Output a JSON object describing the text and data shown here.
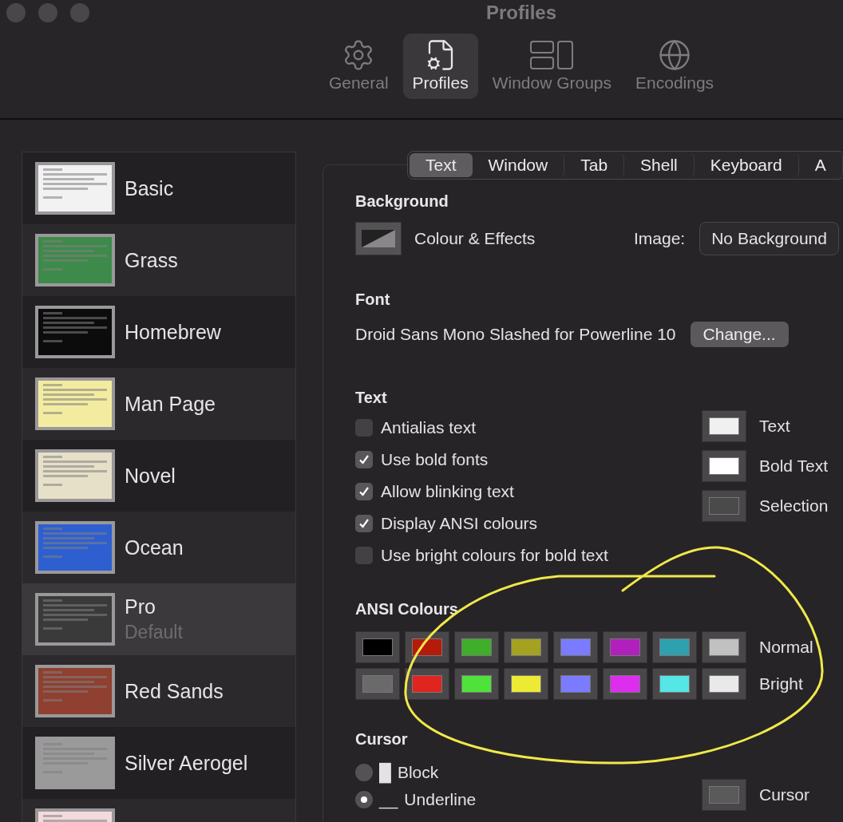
{
  "window": {
    "title": "Profiles"
  },
  "toolbar": [
    {
      "label": "General",
      "kind": "gear",
      "selected": false
    },
    {
      "label": "Profiles",
      "kind": "profile",
      "selected": true
    },
    {
      "label": "Window Groups",
      "kind": "groups",
      "selected": false
    },
    {
      "label": "Encodings",
      "kind": "globe",
      "selected": false
    }
  ],
  "profiles": [
    {
      "name": "Basic",
      "color": "#f2f2f2",
      "selected": false
    },
    {
      "name": "Grass",
      "color": "#3e8a4a",
      "selected": false
    },
    {
      "name": "Homebrew",
      "color": "#0c0c0c",
      "selected": false
    },
    {
      "name": "Man Page",
      "color": "#f3eca0",
      "selected": false
    },
    {
      "name": "Novel",
      "color": "#e6e0c8",
      "selected": false
    },
    {
      "name": "Ocean",
      "color": "#2d5fd0",
      "selected": false
    },
    {
      "name": "Pro",
      "subtitle": "Default",
      "color": "#3a3a3a",
      "selected": true
    },
    {
      "name": "Red Sands",
      "color": "#8f4030",
      "selected": false
    },
    {
      "name": "Silver Aerogel",
      "color": "#9a9a9a",
      "selected": false
    },
    {
      "color": "#f2dadd",
      "selected": false
    }
  ],
  "tabs": [
    {
      "label": "Text",
      "selected": true
    },
    {
      "label": "Window",
      "selected": false
    },
    {
      "label": "Tab",
      "selected": false
    },
    {
      "label": "Shell",
      "selected": false
    },
    {
      "label": "Keyboard",
      "selected": false
    },
    {
      "label": "A",
      "selected": false
    }
  ],
  "background": {
    "heading": "Background",
    "label": "Colour & Effects",
    "image_label": "Image:",
    "image_value": "No Background"
  },
  "font": {
    "heading": "Font",
    "value": "Droid Sans Mono Slashed for Powerline 10",
    "button": "Change..."
  },
  "text": {
    "heading": "Text",
    "options": [
      {
        "label": "Antialias text",
        "checked": false
      },
      {
        "label": "Use bold fonts",
        "checked": true
      },
      {
        "label": "Allow blinking text",
        "checked": true
      },
      {
        "label": "Display ANSI colours",
        "checked": true
      },
      {
        "label": "Use bright colours for bold text",
        "checked": false
      }
    ],
    "colours": [
      {
        "label": "Text",
        "color": "#f0f0f0"
      },
      {
        "label": "Bold Text",
        "color": "#ffffff"
      },
      {
        "label": "Selection",
        "color": "#4a4a4a"
      }
    ]
  },
  "ansi": {
    "heading": "ANSI Colours",
    "rows": [
      {
        "label": "Normal",
        "wells": [
          {
            "color": "#000000"
          },
          {
            "color": "#b51a0a"
          },
          {
            "color": "#3fae2a"
          },
          {
            "color": "#a5a222"
          },
          {
            "color": "#7b7bff"
          },
          {
            "color": "#b120bd"
          },
          {
            "color": "#2ea1ae"
          },
          {
            "color": "#c1c1c1"
          }
        ]
      },
      {
        "label": "Bright",
        "wells": [
          {
            "color": "#6a6a6a"
          },
          {
            "color": "#e0241e"
          },
          {
            "color": "#4ee23a"
          },
          {
            "color": "#ecea35"
          },
          {
            "color": "#7b7bff"
          },
          {
            "color": "#dd2ef0"
          },
          {
            "color": "#55e6e6"
          },
          {
            "color": "#e9e9e9"
          }
        ]
      }
    ]
  },
  "cursor": {
    "heading": "Cursor",
    "options": [
      {
        "label": "Block",
        "glyph": "█",
        "selected": false
      },
      {
        "label": "Underline",
        "glyph": "__",
        "selected": true
      }
    ],
    "colour": {
      "label": "Cursor",
      "color": "#5a5a5a"
    }
  }
}
